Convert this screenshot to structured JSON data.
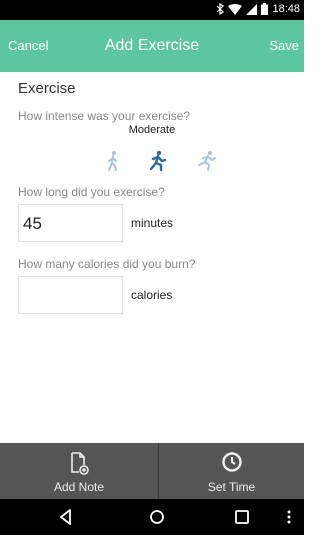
{
  "status": {
    "time": "18:48"
  },
  "appbar": {
    "cancel": "Cancel",
    "title": "Add Exercise",
    "save": "Save"
  },
  "content": {
    "section_title": "Exercise",
    "intensity_question": "How intense was your exercise?",
    "intensity_value": "Moderate",
    "duration_question": "How long did you exercise?",
    "duration_value": "45",
    "duration_unit": "minutes",
    "calories_question": "How many calories did you burn?",
    "calories_value": "",
    "calories_unit": "calories"
  },
  "bottom": {
    "add_note": "Add Note",
    "set_time": "Set Time"
  },
  "colors": {
    "accent": "#5cc79d",
    "runner_selected": "#2b6a9a",
    "runner_light": "#a8c4da"
  }
}
